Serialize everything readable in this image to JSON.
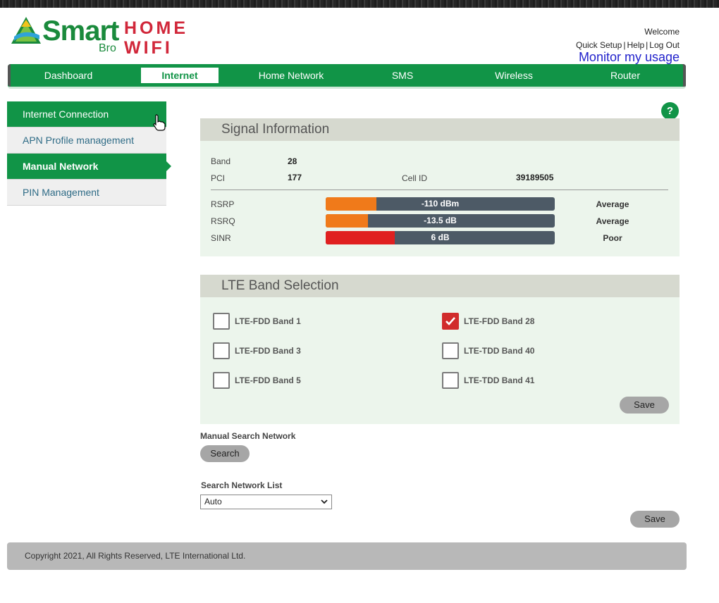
{
  "brand": {
    "smart": "Smart",
    "bro": "Bro",
    "home": "HOME",
    "wifi": "WIFI"
  },
  "header": {
    "welcome": "Welcome",
    "quick_setup": "Quick Setup",
    "help": "Help",
    "logout": "Log Out",
    "separator": "|",
    "monitor": "Monitor my usage"
  },
  "nav": {
    "items": [
      "Dashboard",
      "Internet",
      "Home Network",
      "SMS",
      "Wireless",
      "Router"
    ],
    "active": "Internet"
  },
  "sidebar": {
    "items": [
      "Internet Connection",
      "APN Profile management",
      "Manual Network",
      "PIN Management"
    ]
  },
  "help_icon": "?",
  "signal": {
    "title": "Signal Information",
    "band_label": "Band",
    "band_value": "28",
    "pci_label": "PCI",
    "pci_value": "177",
    "cellid_label": "Cell ID",
    "cellid_value": "39189505",
    "rsrp": {
      "label": "RSRP",
      "value": "-110 dBm",
      "quality": "Average",
      "level": 0.22,
      "color": "#f07a1a"
    },
    "rsrq": {
      "label": "RSRQ",
      "value": "-13.5 dB",
      "quality": "Average",
      "level": 0.185,
      "color": "#f07a1a"
    },
    "sinr": {
      "label": "SINR",
      "value": "6 dB",
      "quality": "Poor",
      "level": 0.3,
      "color": "#e02020"
    }
  },
  "lte": {
    "title": "LTE Band Selection",
    "bands": [
      {
        "label": "LTE-FDD Band 1",
        "checked": false
      },
      {
        "label": "LTE-FDD Band 28",
        "checked": true
      },
      {
        "label": "LTE-FDD Band 3",
        "checked": false
      },
      {
        "label": "LTE-TDD Band 40",
        "checked": false
      },
      {
        "label": "LTE-FDD Band 5",
        "checked": false
      },
      {
        "label": "LTE-TDD Band 41",
        "checked": false
      }
    ],
    "save": "Save"
  },
  "manual_search": {
    "label": "Manual Search Network",
    "button": "Search"
  },
  "network_list": {
    "label": "Search Network List",
    "selected": "Auto"
  },
  "save_bottom": "Save",
  "footer": "Copyright 2021, All Rights Reserved, LTE International Ltd.",
  "colors": {
    "brand_green": "#119447",
    "brand_red": "#d1273a",
    "bar_bg": "#4d5a66"
  }
}
